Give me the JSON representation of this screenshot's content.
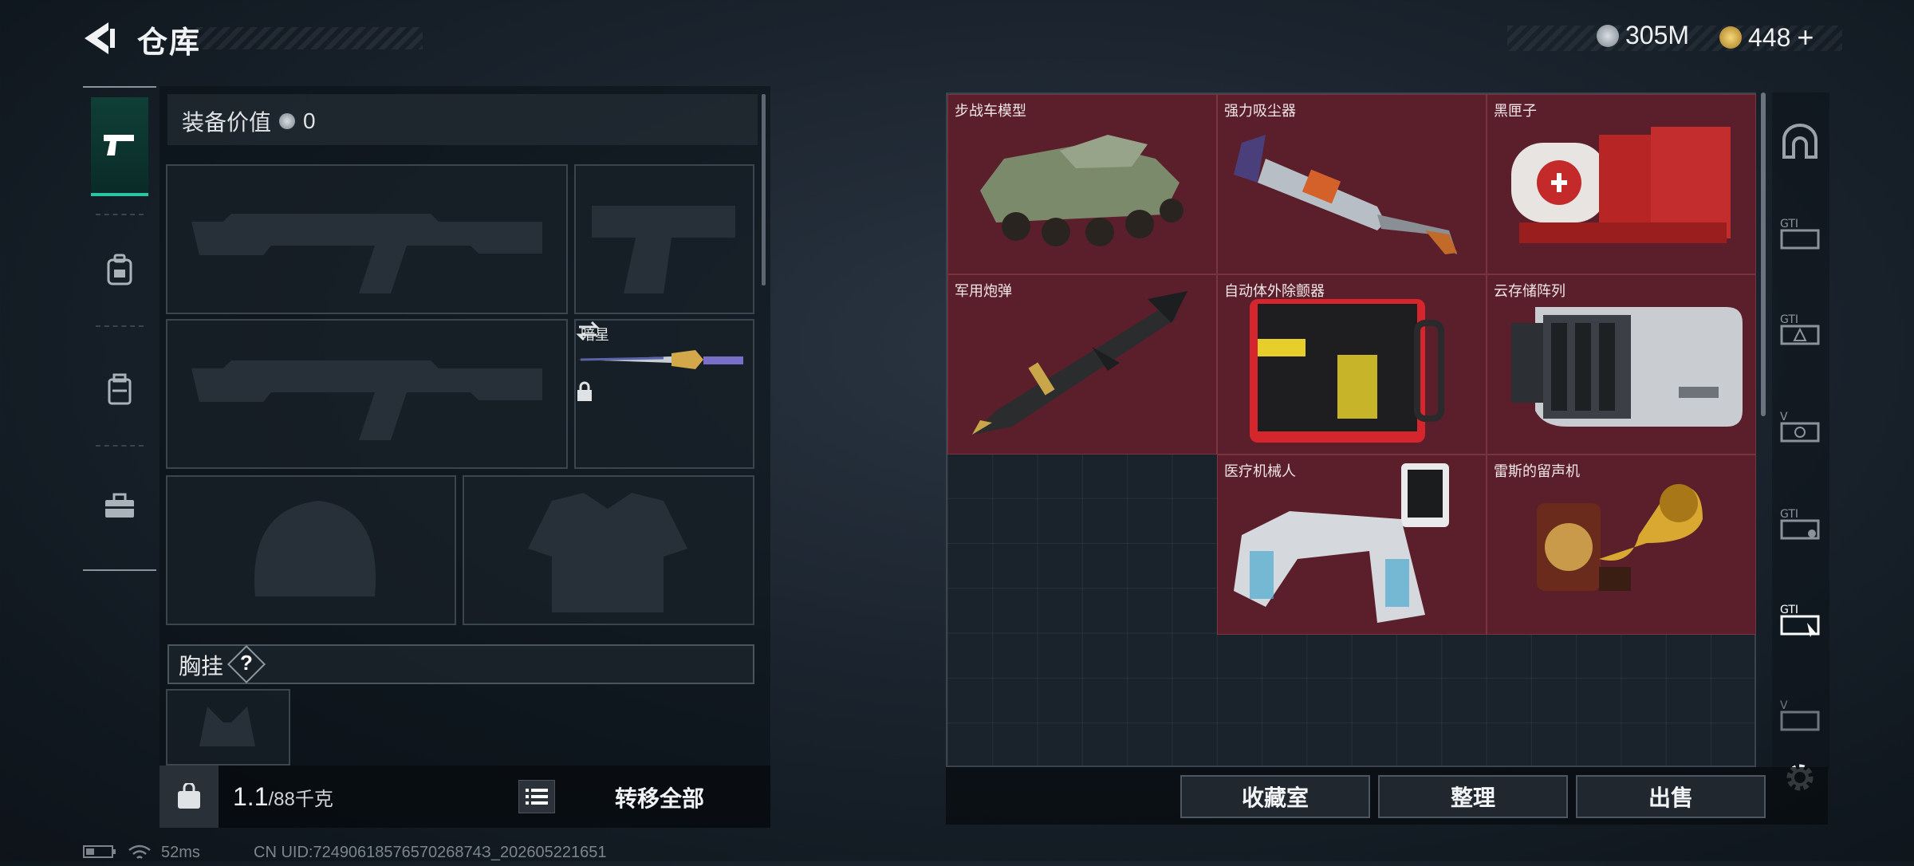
{
  "header": {
    "title": "仓库"
  },
  "currency": {
    "silver": "305M",
    "gold": "448",
    "gold_add": "+"
  },
  "loadout": {
    "value_label": "装备价值",
    "value": "0",
    "melee_slot": {
      "name": "暗星"
    },
    "chest_label": "胸挂",
    "chest_help": "?",
    "weight_current": "1.1",
    "weight_max": "/88千克",
    "transfer_all": "转移全部"
  },
  "tabs": [
    {
      "icon": "pistol-icon",
      "active": true
    },
    {
      "icon": "backpack-icon",
      "active": false
    },
    {
      "icon": "container-icon",
      "active": false
    },
    {
      "icon": "toolbox-icon",
      "active": false
    }
  ],
  "storage": {
    "items": [
      {
        "name": "步战车模型"
      },
      {
        "name": "强力吸尘器"
      },
      {
        "name": "黑匣子"
      },
      {
        "name": "军用炮弹"
      },
      {
        "name": "自动体外除颤器"
      },
      {
        "name": "云存储阵列"
      },
      {
        "name": "医疗机械人"
      },
      {
        "name": "雷斯的留声机"
      }
    ],
    "item_bg": "#5a1f2a"
  },
  "actions": {
    "collection": "收藏室",
    "organize": "整理",
    "sell": "出售"
  },
  "status": {
    "ping": "52ms",
    "uid": "CN UID:7249061857657026874З_202605221651"
  },
  "colors": {
    "accent": "#28c6a4",
    "item_red": "#5a1f2a"
  }
}
